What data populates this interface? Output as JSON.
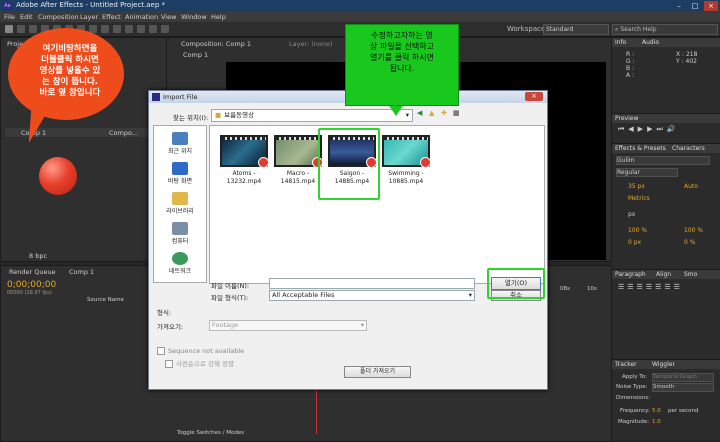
{
  "window": {
    "title": "Adobe After Effects - Untitled Project.aep *",
    "logo": "Ae"
  },
  "menu": [
    "File",
    "Edit",
    "Composition",
    "Layer",
    "Effect",
    "Animation",
    "View",
    "Window",
    "Help"
  ],
  "toolbar": {
    "workspace_label": "Workspace:",
    "workspace_value": "Standard",
    "search_placeholder": "Search Help"
  },
  "project_panel": {
    "tab": "Project",
    "items": [
      "Comp 1",
      "Compo..."
    ],
    "bpc": "8 bpc"
  },
  "comp_panel": {
    "tab": "Composition: Comp 1",
    "layer_tab": "Layer: (none)",
    "subtab": "Comp 1"
  },
  "timeline": {
    "render_tab": "Render Queue",
    "comp_tab": "Comp 1",
    "timecode": "0;00;00;00",
    "frames": "00000 (29.97 fps)",
    "source_name": "Source Name",
    "marker": "08s",
    "marker2": "10s",
    "bottom_label": "Toggle Switches / Modes"
  },
  "right_panel": {
    "info_tab": "Info",
    "audio_tab": "Audio",
    "info": {
      "r": "R :",
      "g": "G :",
      "b": "B :",
      "a": "A :",
      "x": "X : 218",
      "y": "Y : 402"
    },
    "preview_tab": "Preview",
    "effects_tab": "Effects & Presets",
    "characters_tab": "Characters",
    "font": "Gulim",
    "style": "Regular",
    "size": "35 px",
    "leading": "Auto",
    "kerning": "Metrics",
    "unit": "px",
    "scale_v": "100 %",
    "scale_h": "100 %",
    "baseline": "0 px",
    "tsume": "0 %",
    "paragraph_tab": "Paragraph",
    "align_tab": "Align",
    "smoother_tab": "Smo",
    "tracker_tab": "Tracker",
    "wiggler_tab": "Wiggler",
    "apply_to": "Apply To:",
    "apply_to_value": "Temporal Graph",
    "noise_type": "Noise Type:",
    "noise_value": "Smooth",
    "dimensions": "Dimensions:",
    "frequency": "Frequency:",
    "frequency_value": "5.0",
    "frequency_unit": "per second",
    "magnitude": "Magnitude:",
    "magnitude_value": "1.0"
  },
  "bubble": {
    "lines": [
      "여기비탕하면을",
      "더블클릭 하시면",
      "영상를 넣을수 있",
      "는 창이 뜹니다.",
      "바로 옆 창입니다"
    ]
  },
  "callout": {
    "lines": [
      "수정하고자하는 영",
      "상 파일을 선택하고",
      "열기를 클릭 하시면",
      "됩니다."
    ]
  },
  "dialog": {
    "title": "Import File",
    "lookin_label": "찾는 위치(I):",
    "lookin_value": "보름동영상",
    "places": [
      "최근 위치",
      "바탕 화면",
      "라이브러리",
      "컴퓨터",
      "네트워크"
    ],
    "files": [
      "Atoms - 13232.mp4",
      "Macro - 14815.mp4",
      "Saigon - 14885.mp4",
      "Swimming - 10885.mp4"
    ],
    "filename_label": "파일 이름(N):",
    "filetype_label": "파일 형식(T):",
    "filetype_value": "All Acceptable Files",
    "open_label": "열기(O)",
    "cancel_label": "취소",
    "format_label": "형식:",
    "import_as_label": "가져오기:",
    "import_as_value": "Footage",
    "sequence_label": "Sequence not available",
    "force_alpha_label": "사전순으로 강제 정렬",
    "import_folder_label": "폴더 가져오기"
  },
  "colors": {
    "bubble": "#ef4c1c",
    "callout": "#18c81c",
    "highlight": "#2fd42f"
  }
}
